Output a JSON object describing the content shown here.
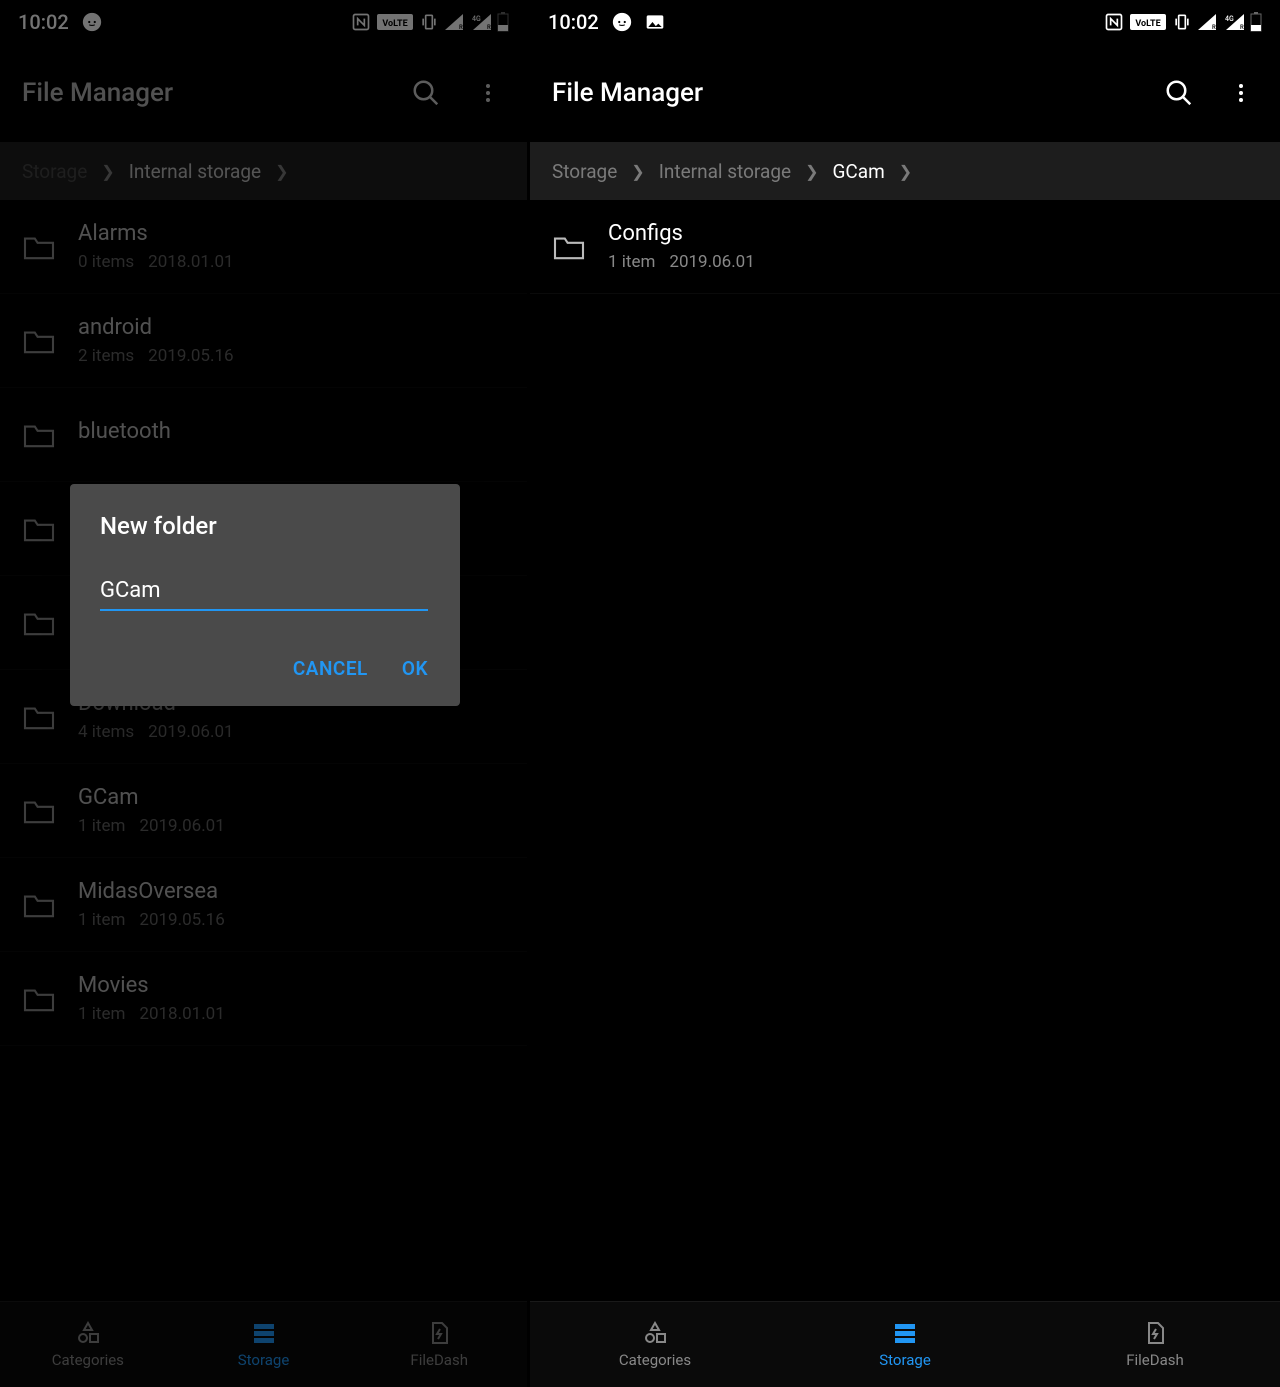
{
  "status": {
    "time": "10:02"
  },
  "left": {
    "app_title": "File Manager",
    "breadcrumb": [
      {
        "label": "Storage",
        "dim": true
      },
      {
        "label": "Internal storage",
        "dim": false
      }
    ],
    "folders": [
      {
        "name": "Alarms",
        "items": "0 items",
        "date": "2018.01.01"
      },
      {
        "name": "android",
        "items": "2 items",
        "date": "2019.05.16"
      },
      {
        "name": "bluetooth",
        "items": "",
        "date": ""
      },
      {
        "name": "",
        "items": "",
        "date": ""
      },
      {
        "name": "",
        "items": "",
        "date": ""
      },
      {
        "name": "Download",
        "items": "4 items",
        "date": "2019.06.01"
      },
      {
        "name": "GCam",
        "items": "1 item",
        "date": "2019.06.01"
      },
      {
        "name": "MidasOversea",
        "items": "1 item",
        "date": "2019.05.16"
      },
      {
        "name": "Movies",
        "items": "1 item",
        "date": "2018.01.01"
      }
    ],
    "dialog": {
      "title": "New folder",
      "value": "GCam",
      "cancel": "CANCEL",
      "ok": "OK"
    }
  },
  "right": {
    "app_title": "File Manager",
    "breadcrumb": [
      {
        "label": "Storage",
        "dim": true
      },
      {
        "label": "Internal storage",
        "dim": true
      },
      {
        "label": "GCam",
        "dim": false
      }
    ],
    "folders": [
      {
        "name": "Configs",
        "items": "1 item",
        "date": "2019.06.01"
      }
    ]
  },
  "nav": {
    "categories": "Categories",
    "storage": "Storage",
    "filedash": "FileDash"
  }
}
